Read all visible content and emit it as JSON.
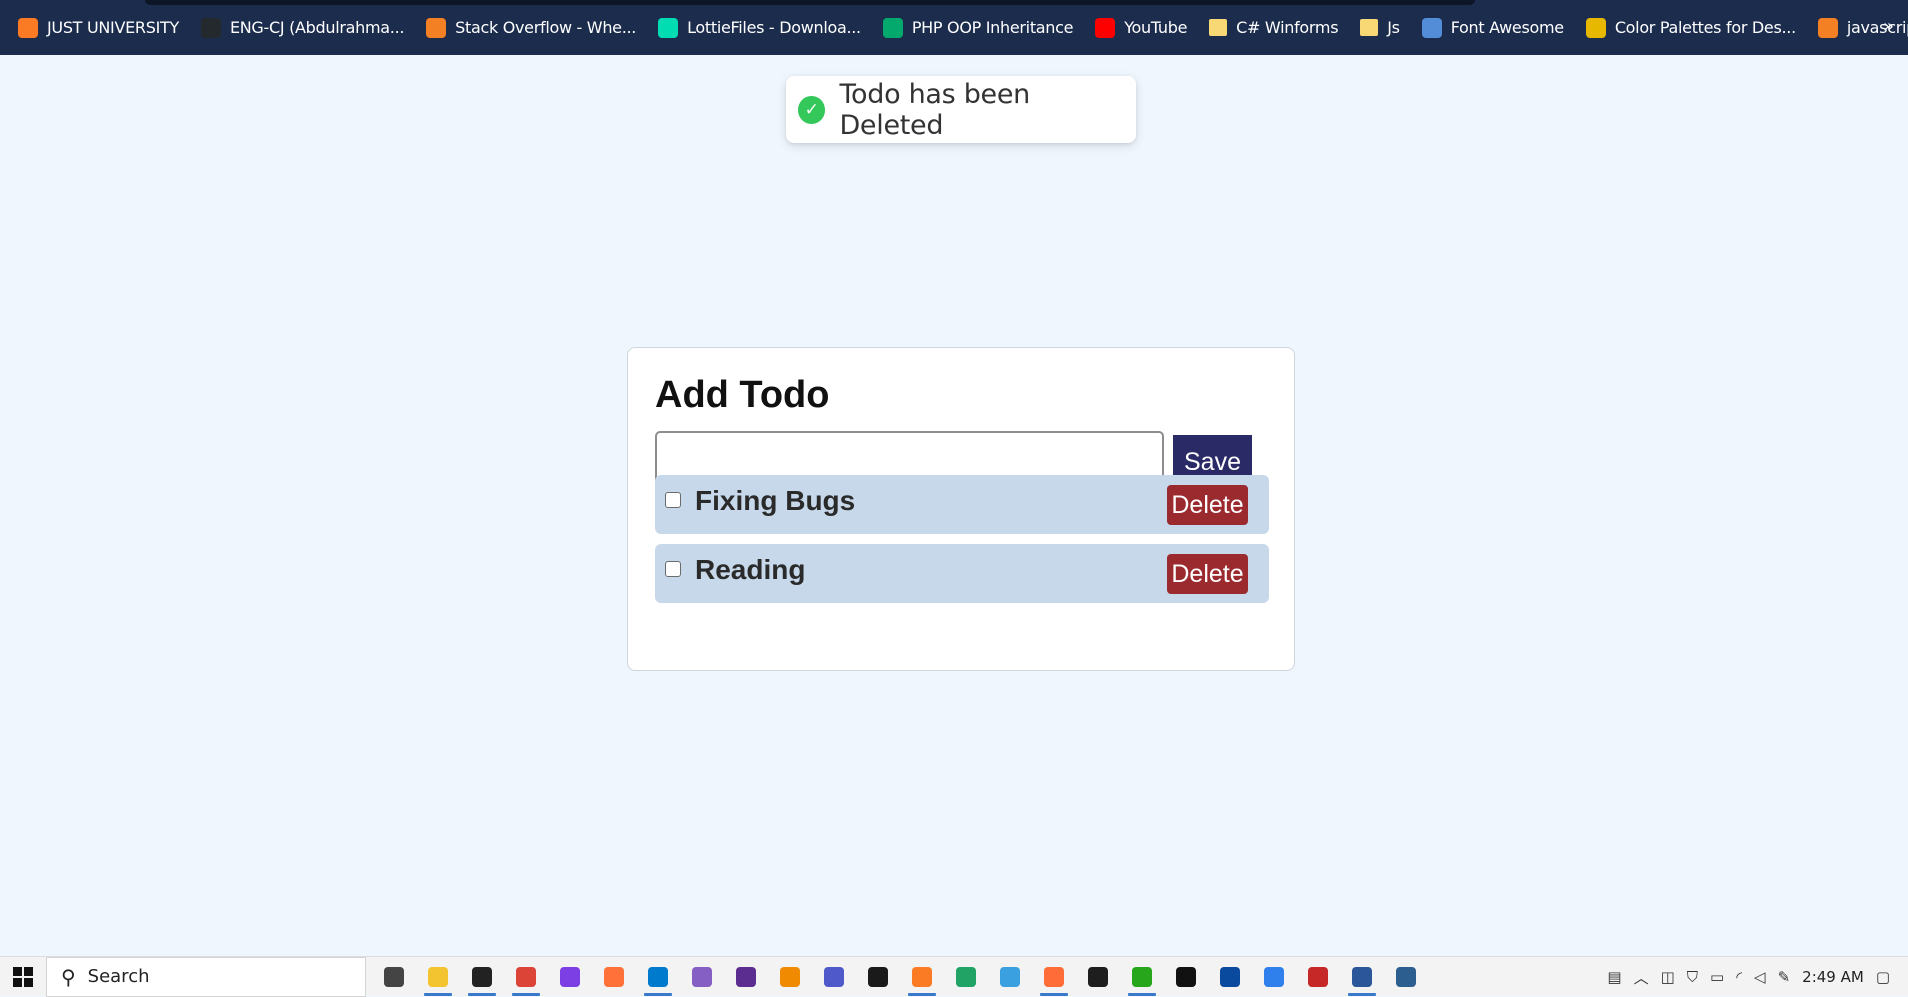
{
  "bookmarks": [
    {
      "label": "JUST UNIVERSITY",
      "icon": "xampp-icon",
      "color": "#fb7a24"
    },
    {
      "label": "ENG-CJ (Abdulrahma...",
      "icon": "github-icon",
      "color": "#24292e"
    },
    {
      "label": "Stack Overflow - Whe...",
      "icon": "stackoverflow-icon",
      "color": "#f48024"
    },
    {
      "label": "LottieFiles - Downloa...",
      "icon": "lottiefiles-icon",
      "color": "#00ddb3"
    },
    {
      "label": "PHP OOP Inheritance",
      "icon": "w3schools-icon",
      "color": "#04aa6d"
    },
    {
      "label": "YouTube",
      "icon": "youtube-icon",
      "color": "#ff0000"
    },
    {
      "label": "C# Winforms",
      "icon": "folder-icon",
      "color": "#f8d775"
    },
    {
      "label": "Js",
      "icon": "folder-icon",
      "color": "#f8d775"
    },
    {
      "label": "Font Awesome",
      "icon": "flag-icon",
      "color": "#538dd7"
    },
    {
      "label": "Color Palettes for Des...",
      "icon": "palette-icon",
      "color": "#e6b800"
    },
    {
      "label": "javascript - Google ch...",
      "icon": "stackoverflow-icon",
      "color": "#f48024"
    }
  ],
  "bookmarks_more": "»",
  "toast": {
    "message": "Todo has been Deleted",
    "icon": "check-circle-icon",
    "icon_color": "#34c759"
  },
  "card": {
    "title": "Add Todo",
    "input": {
      "value": "",
      "placeholder": ""
    },
    "save_label": "Save",
    "todos": [
      {
        "label": "Fixing Bugs",
        "checked": false,
        "delete_label": "Delete"
      },
      {
        "label": "Reading",
        "checked": false,
        "delete_label": "Delete"
      }
    ]
  },
  "colors": {
    "page_bg": "#eff6fe",
    "save_button": "#2a2a66",
    "delete_button": "#9b2a2f",
    "todo_row_bg": "#c6d8ea"
  },
  "taskbar": {
    "search_label": "Search",
    "apps": [
      {
        "name": "task-view-icon",
        "color": "#444444",
        "active": false
      },
      {
        "name": "file-explorer-icon",
        "color": "#f4c430",
        "active": true
      },
      {
        "name": "terminal-icon",
        "color": "#222222",
        "active": true
      },
      {
        "name": "chrome-icon",
        "color": "#db4437",
        "active": true
      },
      {
        "name": "phpstorm-icon",
        "color": "#7b3fe4",
        "active": false
      },
      {
        "name": "firefox-icon",
        "color": "#ff7139",
        "active": false
      },
      {
        "name": "vscode-icon",
        "color": "#007acc",
        "active": true
      },
      {
        "name": "visual-studio-icon",
        "color": "#865fc5",
        "active": false
      },
      {
        "name": "visual-studio-dark-icon",
        "color": "#5c2d91",
        "active": false
      },
      {
        "name": "app-orange-icon",
        "color": "#f08a00",
        "active": false
      },
      {
        "name": "teams-icon",
        "color": "#5059c9",
        "active": false
      },
      {
        "name": "app-dark-icon",
        "color": "#1a1a1a",
        "active": false
      },
      {
        "name": "xampp-icon",
        "color": "#fb7a24",
        "active": true
      },
      {
        "name": "spreadsheet-icon",
        "color": "#21a366",
        "active": false
      },
      {
        "name": "photos-icon",
        "color": "#3aa0e0",
        "active": false
      },
      {
        "name": "postman-icon",
        "color": "#ff6c37",
        "active": true
      },
      {
        "name": "figma-icon",
        "color": "#1e1e1e",
        "active": false
      },
      {
        "name": "camtasia-icon",
        "color": "#27a61b",
        "active": true
      },
      {
        "name": "notion-icon",
        "color": "#111111",
        "active": false
      },
      {
        "name": "remote-icon",
        "color": "#0a4a9e",
        "active": false
      },
      {
        "name": "todo-icon",
        "color": "#2f80ed",
        "active": false
      },
      {
        "name": "app-red-icon",
        "color": "#c62828",
        "active": false
      },
      {
        "name": "word-icon",
        "color": "#2b579a",
        "active": true
      },
      {
        "name": "app-blue-icon",
        "color": "#2c5e8f",
        "active": false
      }
    ],
    "tray": {
      "icons": [
        "news-icon",
        "chevron-up-icon",
        "camera-icon",
        "shield-icon",
        "battery-icon",
        "wifi-icon",
        "volume-icon",
        "pen-icon"
      ],
      "time": "2:49 AM",
      "notifications_icon": "notification-icon"
    }
  }
}
